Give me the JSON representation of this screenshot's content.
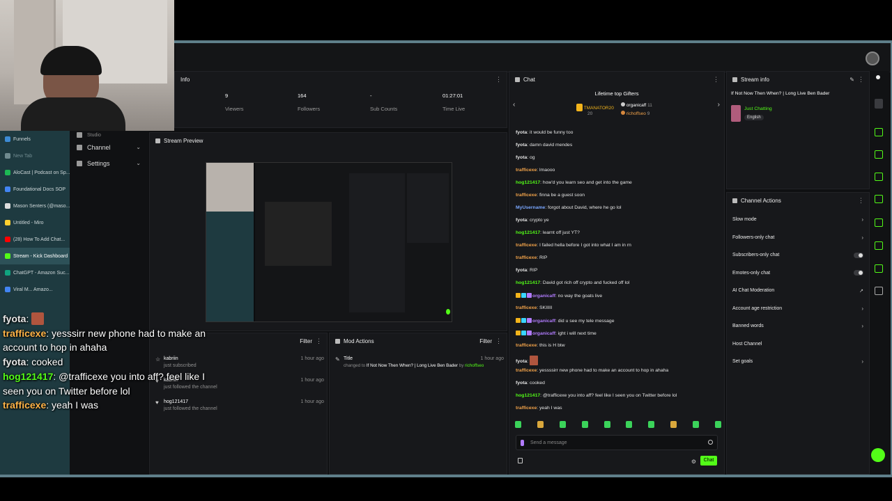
{
  "stats": [
    {
      "value": "9",
      "label": "Viewers"
    },
    {
      "value": "164",
      "label": "Followers"
    },
    {
      "value": "-",
      "label": "Sub Counts"
    },
    {
      "value": "01:27:01",
      "label": "Time Live"
    }
  ],
  "stats_header": "Info",
  "tabs": [
    {
      "label": "Funnels",
      "color": "#3d8bd4"
    },
    {
      "label": "New Tab",
      "color": "#6f8a8f"
    },
    {
      "label": "AloCast | Podcast on Sp...",
      "color": "#1db954"
    },
    {
      "label": "Foundational Docs SOP",
      "color": "#4285f4"
    },
    {
      "label": "Mason Senters (@maso...",
      "color": "#dddddd"
    },
    {
      "label": "Untitled - Miro",
      "color": "#ffd02f"
    },
    {
      "label": "(28) How To Add Chat...",
      "color": "#ff0000"
    },
    {
      "label": "Stream - Kick Dashboard",
      "color": "#53fc18"
    },
    {
      "label": "ChatGPT - Amazon Suc...",
      "color": "#10a37f"
    },
    {
      "label": "Viral M... Amazo...",
      "color": "#4285f4"
    }
  ],
  "nav": {
    "channel": "Channel",
    "settings": "Settings",
    "studio": "Studio"
  },
  "preview": {
    "title": "Stream Preview"
  },
  "activity": {
    "filter": "Filter",
    "rows": [
      {
        "name": "kabriin",
        "sub": "just subscribed",
        "time": "1 hour ago"
      },
      {
        "name": "kabriin",
        "sub": "just followed the channel",
        "time": "1 hour ago"
      },
      {
        "name": "hog121417",
        "sub": "just followed the channel",
        "time": "1 hour ago"
      }
    ]
  },
  "mod": {
    "title": "Mod Actions",
    "filter": "Filter",
    "row_title": "Title",
    "row_desc": "changed to",
    "row_value": "If Not Now Then When? | Long Live Ben Bader",
    "row_by": "by",
    "row_user": "richoffseo",
    "row_time": "1 hour ago"
  },
  "chat": {
    "title": "Chat",
    "gifters_title": "Lifetime top Gifters",
    "gifters": [
      {
        "name": "TMANATOR20",
        "count": "20"
      },
      {
        "name": "organicaff",
        "count": "11"
      },
      {
        "name": "richoffseo",
        "count": "9"
      }
    ],
    "messages": [
      {
        "user": "fyota",
        "color": "#e5e5e5",
        "text": "it would be funny too"
      },
      {
        "user": "fyota",
        "color": "#e5e5e5",
        "text": "damn david mendes"
      },
      {
        "user": "fyota",
        "color": "#e5e5e5",
        "text": "og"
      },
      {
        "user": "trafficexe",
        "color": "#f2a34a",
        "text": "lmaooo"
      },
      {
        "user": "hog121417",
        "color": "#53fc18",
        "text": "how'd you learn seo and get into the game"
      },
      {
        "user": "trafficexe",
        "color": "#f2a34a",
        "text": "finna be a guest soon"
      },
      {
        "user": "MyUsername",
        "color": "#7aa7ff",
        "text": "forgot about David, where he go lol"
      },
      {
        "user": "fyota",
        "color": "#e5e5e5",
        "text": "crypto ye"
      },
      {
        "user": "hog121417",
        "color": "#53fc18",
        "text": "learnt off just YT?"
      },
      {
        "user": "trafficexe",
        "color": "#f2a34a",
        "text": "I failed hella before I got into what I am in rn"
      },
      {
        "user": "trafficexe",
        "color": "#f2a34a",
        "text": "RIP"
      },
      {
        "user": "fyota",
        "color": "#e5e5e5",
        "text": "RIP"
      },
      {
        "user": "hog121417",
        "color": "#53fc18",
        "text": "David got rich off crypto and fucked off lol"
      },
      {
        "user": "organicaff",
        "color": "#b27cff",
        "text": "no way the goats live",
        "badges": true
      },
      {
        "user": "trafficexe",
        "color": "#f2a34a",
        "text": "SKIIIII"
      },
      {
        "user": "organicaff",
        "color": "#b27cff",
        "text": "did u see my tele message",
        "badges": true
      },
      {
        "user": "organicaff",
        "color": "#b27cff",
        "text": "ight i will next time",
        "badges": true
      },
      {
        "user": "trafficexe",
        "color": "#f2a34a",
        "text": "this is H btw"
      },
      {
        "user": "fyota",
        "color": "#e5e5e5",
        "text": ""
      },
      {
        "user": "trafficexe",
        "color": "#f2a34a",
        "text": "yessssirr new phone had to make an account to hop in ahaha"
      },
      {
        "user": "fyota",
        "color": "#e5e5e5",
        "text": "cooked"
      },
      {
        "user": "hog121417",
        "color": "#53fc18",
        "text": "@trafficexe you into aff? feel like I seen you on Twitter before lol"
      },
      {
        "user": "trafficexe",
        "color": "#f2a34a",
        "text": "yeah I was"
      }
    ],
    "placeholder": "Send a message",
    "send_label": "Chat"
  },
  "stream_info": {
    "title": "Stream info",
    "stream_title": "If Not Now Then When? | Long Live Ben Bader",
    "category": "Just Chatting",
    "language": "English"
  },
  "channel_actions": {
    "title": "Channel Actions",
    "items": [
      {
        "label": "Slow mode",
        "control": "chevron"
      },
      {
        "label": "Followers-only chat",
        "control": "chevron"
      },
      {
        "label": "Subscribers-only chat",
        "control": "toggle"
      },
      {
        "label": "Emotes-only chat",
        "control": "toggle"
      },
      {
        "label": "AI Chat Moderation",
        "control": "external"
      },
      {
        "label": "Account age restriction",
        "control": "chevron"
      },
      {
        "label": "Banned words",
        "control": "chevron"
      },
      {
        "label": "Host Channel",
        "control": "none"
      },
      {
        "label": "Set goals",
        "control": "chevron"
      }
    ]
  },
  "overlay": [
    {
      "user": "fyota",
      "text": "",
      "color": "#e8e8e8"
    },
    {
      "user": "trafficexe",
      "text": "yesssirr new phone had to make an account to hop in ahaha",
      "color": "#ffb347"
    },
    {
      "user": "fyota",
      "text": "cooked",
      "color": "#e8e8e8"
    },
    {
      "user": "hog121417",
      "text": "@trafficexe you into aff? feel like I seen you on Twitter before lol",
      "color": "#53fc18"
    },
    {
      "user": "trafficexe",
      "text": "yeah I was",
      "color": "#ffb347"
    }
  ],
  "colors": {
    "accent": "#53fc18",
    "background": "#0f1012",
    "panel": "#17181b"
  }
}
